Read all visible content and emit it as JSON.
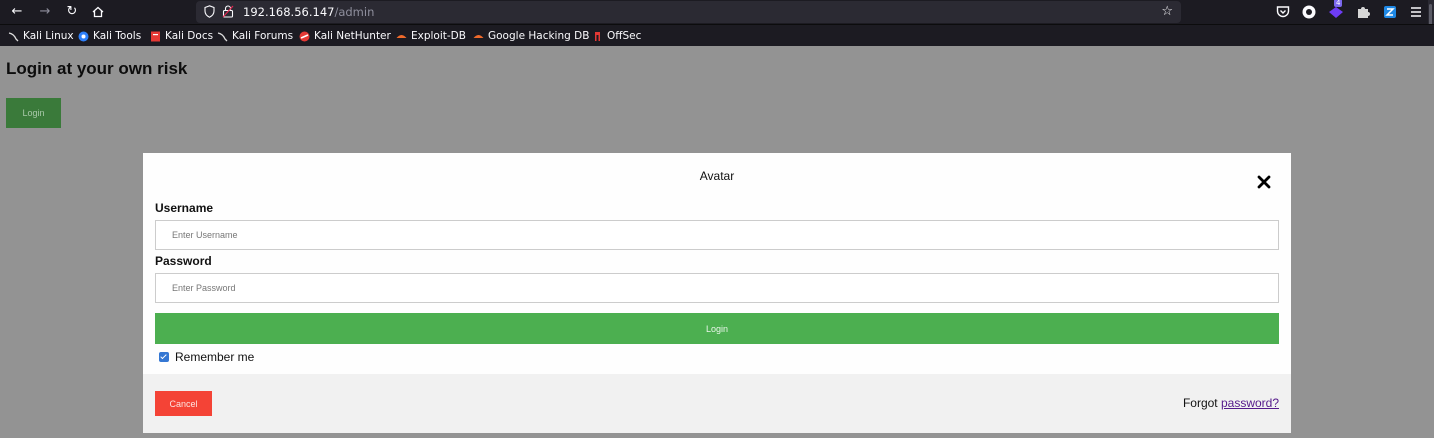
{
  "browser": {
    "url_host": "192.168.56.147",
    "url_path": "/admin",
    "icons": [
      "back-icon",
      "forward-icon",
      "reload-icon",
      "home-icon",
      "shield-icon",
      "lock-icon",
      "star-icon",
      "pocket-icon",
      "account-icon",
      "extension-badge-icon",
      "extension-puzzle-icon",
      "extension-z-icon",
      "menu-icon"
    ],
    "badge_count": "4",
    "bookmarks": [
      {
        "label": "Kali Linux",
        "icon": "kali-dragon-icon",
        "color": "#dddddd"
      },
      {
        "label": "Kali Tools",
        "icon": "kali-tools-icon",
        "color": "#2d7ff9"
      },
      {
        "label": "Kali Docs",
        "icon": "kali-docs-icon",
        "color": "#e53935"
      },
      {
        "label": "Kali Forums",
        "icon": "kali-dragon-icon",
        "color": "#dddddd"
      },
      {
        "label": "Kali NetHunter",
        "icon": "nethunter-icon",
        "color": "#e53935"
      },
      {
        "label": "Exploit-DB",
        "icon": "exploit-db-icon",
        "color": "#f06a2b"
      },
      {
        "label": "Google Hacking DB",
        "icon": "ghdb-icon",
        "color": "#f06a2b"
      },
      {
        "label": "OffSec",
        "icon": "offsec-icon",
        "color": "#e53935"
      }
    ]
  },
  "page": {
    "heading": "Login at your own risk",
    "login_button": "Login"
  },
  "modal": {
    "title": "Avatar",
    "close_icon": "close-icon",
    "username_label": "Username",
    "username_placeholder": "Enter Username",
    "password_label": "Password",
    "password_placeholder": "Enter Password",
    "submit_label": "Login",
    "remember_label": "Remember me",
    "remember_checked": true,
    "cancel_label": "Cancel",
    "forgot_text": "Forgot",
    "forgot_link": "password?"
  },
  "colors": {
    "overlay": "#939393",
    "submit_green": "#4caf50",
    "cancel_red": "#f44336",
    "link_purple": "#551a8b",
    "checkbox_blue": "#3477d3"
  }
}
